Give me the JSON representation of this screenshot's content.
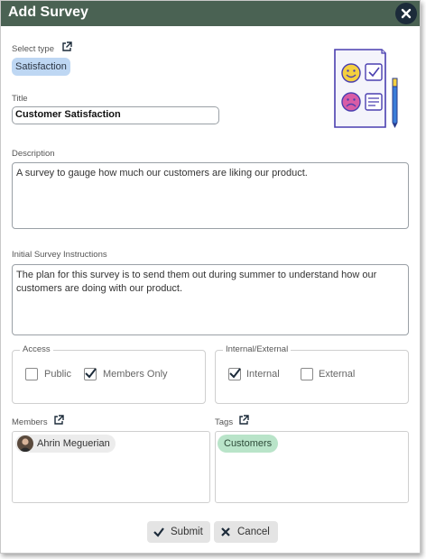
{
  "dialog": {
    "title": "Add Survey"
  },
  "select_type": {
    "label": "Select type",
    "value": "Satisfaction"
  },
  "title_field": {
    "label": "Title",
    "value": "Customer Satisfaction"
  },
  "description": {
    "label": "Description",
    "value": "A survey to gauge how much our customers are liking our product."
  },
  "instructions": {
    "label": "Initial Survey Instructions",
    "value": "The plan for this survey is to send them out during summer to understand how our customers are doing with our product."
  },
  "access": {
    "legend": "Access",
    "options": [
      {
        "label": "Public",
        "checked": false
      },
      {
        "label": "Members Only",
        "checked": true
      }
    ]
  },
  "internal_external": {
    "legend": "Internal/External",
    "options": [
      {
        "label": "Internal",
        "checked": true
      },
      {
        "label": "External",
        "checked": false
      }
    ]
  },
  "members": {
    "label": "Members",
    "items": [
      {
        "name": "Ahrin Meguerian"
      }
    ]
  },
  "tags": {
    "label": "Tags",
    "items": [
      {
        "name": "Customers"
      }
    ]
  },
  "buttons": {
    "submit": "Submit",
    "cancel": "Cancel"
  },
  "colors": {
    "titlebar": "#4a6253",
    "type_chip": "#bed7f3",
    "tag_chip": "#b9e4c9",
    "close_button": "#1c2b3a"
  },
  "icons": {
    "close": "close-icon",
    "external_link": "external-link-icon",
    "submit": "check-icon",
    "cancel": "x-icon",
    "illustration": "survey-illustration"
  }
}
